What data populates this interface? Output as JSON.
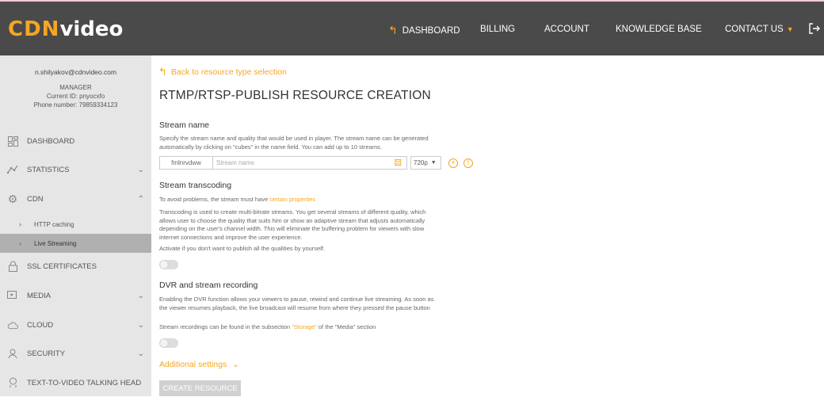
{
  "logo": {
    "cdn": "CDN",
    "video": "video"
  },
  "nav": {
    "dashboard": "DASHBOARD",
    "billing": "BILLING",
    "account": "ACCOUNT",
    "knowledge_base": "KNOWLEDGE BASE",
    "contact_us": "CONTACT US"
  },
  "profile": {
    "email": "n.shilyakov@cdnvideo.com",
    "role": "MANAGER",
    "current_id": "Current ID: pnyocxfo",
    "phone": "Phone number: 79859334123"
  },
  "sidebar": {
    "items": [
      {
        "label": "DASHBOARD",
        "icon": "dashboard-icon"
      },
      {
        "label": "STATISTICS",
        "icon": "statistics-icon"
      },
      {
        "label": "CDN",
        "icon": "gear-icon"
      },
      {
        "label": "SSL CERTIFICATES",
        "icon": "lock-icon"
      },
      {
        "label": "MEDIA",
        "icon": "media-icon"
      },
      {
        "label": "CLOUD",
        "icon": "cloud-icon"
      },
      {
        "label": "SECURITY",
        "icon": "security-icon"
      },
      {
        "label": "TEXT-TO-VIDEO TALKING HEAD",
        "icon": "head-icon"
      }
    ],
    "cdn_sub": [
      {
        "label": "HTTP caching"
      },
      {
        "label": "Live Streaming"
      }
    ]
  },
  "main": {
    "back_label": "Back to resource type selection",
    "title": "RTMP/RTSP-PUBLISH RESOURCE CREATION",
    "stream_name": {
      "heading": "Stream name",
      "desc": "Specify the stream name and quality that would be used in player. The stream name can be generated automatically by clicking on \"cubes\" in the name field. You can add up to 10 streams.",
      "prefix": "fmlnrvdww",
      "placeholder": "Stream name",
      "quality": "720p"
    },
    "transcoding": {
      "heading": "Stream transcoding",
      "avoid_text": "To avoid problems, the stream must have ",
      "avoid_link": "certain properties",
      "desc": "Transcoding is used to create multi-bitrate streams. You get several streams of different quality, which allows user to choose the quality that suits him or show an adaptive stream that adjusts automatically depending on the user's channel width. This will eliminate the buffering problem for viewers with slow internet connections and improve the user experience.",
      "activate": "Activate if you don't want to publish all the qualities by yourself."
    },
    "dvr": {
      "heading": "DVR and stream recording",
      "desc": "Enabling the DVR function allows your viewers to pause, rewind and continue live streaming. As soon as the viewer resumes playback, the live broadcast will resume from where they pressed the pause button",
      "rec_pre": "Stream recordings can be found in the subsection ",
      "rec_link": "\"Storage\"",
      "rec_post": " of the \"Media\" section"
    },
    "additional_settings": "Additional settings",
    "create_button": "CREATE RESOURCE"
  },
  "colors": {
    "accent": "#f5a623",
    "header_bg": "#4a4a4a",
    "sidebar_bg": "#e6e6e6"
  }
}
